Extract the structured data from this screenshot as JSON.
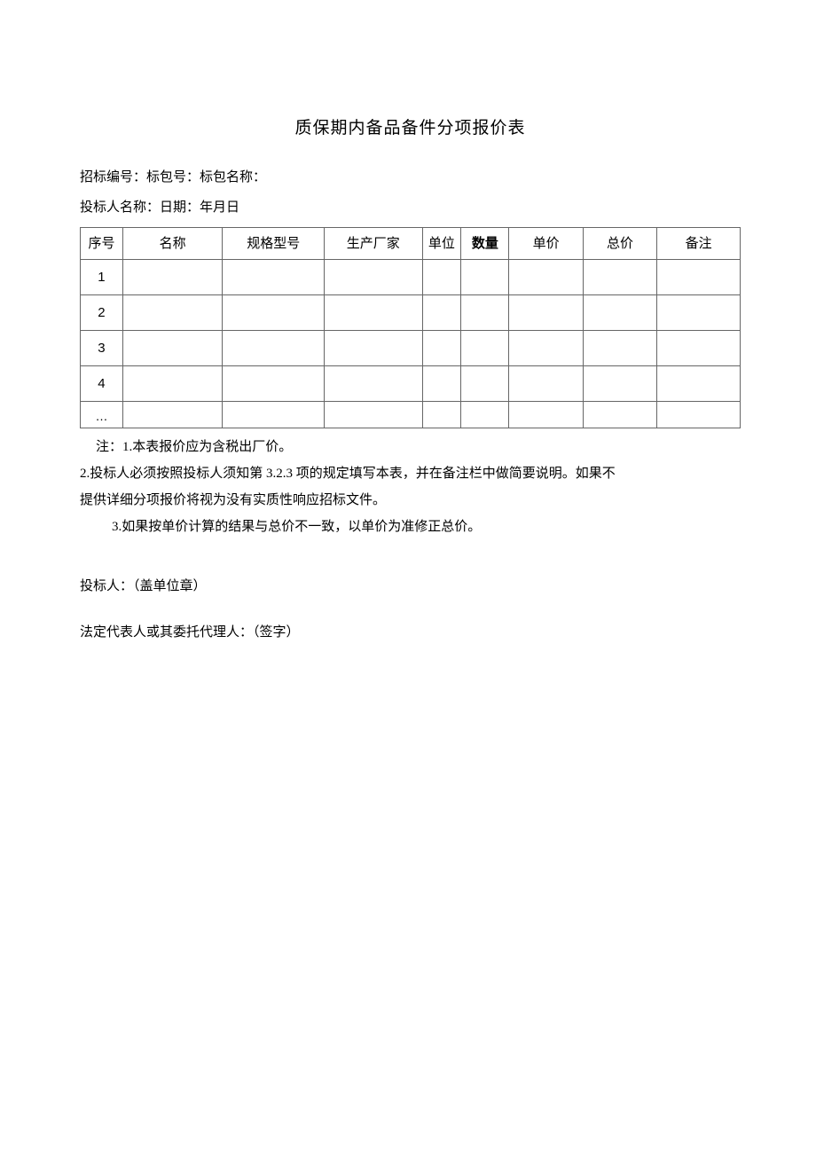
{
  "title": "质保期内备品备件分项报价表",
  "meta": {
    "line1": "招标编号：标包号：标包名称：",
    "line2": "投标人名称：日期：年月日"
  },
  "table": {
    "headers": [
      "序号",
      "名称",
      "规格型号",
      "生产厂家",
      "单位",
      "数量",
      "单价",
      "总价",
      "备注"
    ],
    "rows": [
      {
        "seq": "1",
        "name": "",
        "spec": "",
        "mfr": "",
        "unit": "",
        "qty": "",
        "price": "",
        "total": "",
        "remark": ""
      },
      {
        "seq": "2",
        "name": "",
        "spec": "",
        "mfr": "",
        "unit": "",
        "qty": "",
        "price": "",
        "total": "",
        "remark": ""
      },
      {
        "seq": "3",
        "name": "",
        "spec": "",
        "mfr": "",
        "unit": "",
        "qty": "",
        "price": "",
        "total": "",
        "remark": ""
      },
      {
        "seq": "4",
        "name": "",
        "spec": "",
        "mfr": "",
        "unit": "",
        "qty": "",
        "price": "",
        "total": "",
        "remark": ""
      },
      {
        "seq": "…",
        "name": "",
        "spec": "",
        "mfr": "",
        "unit": "",
        "qty": "",
        "price": "",
        "total": "",
        "remark": ""
      }
    ]
  },
  "notes": {
    "n1": "注：1.本表报价应为含税出厂价。",
    "n2a": "2.投标人必须按照投标人须知第 3.2.3 项的规定填写本表，并在备注栏中做简要说明。如果不",
    "n2b": "提供详细分项报价将视为没有实质性响应招标文件。",
    "n3": "3.如果按单价计算的结果与总价不一致，以单价为准修正总价。"
  },
  "sig": {
    "bidder": "投标人：（盖单位章）",
    "rep": "法定代表人或其委托代理人：（签字）"
  }
}
